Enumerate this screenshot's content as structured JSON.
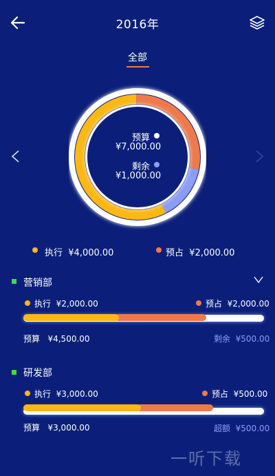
{
  "header": {
    "title": "2016年",
    "back_icon": "arrow-left-icon",
    "layers_icon": "layers-icon"
  },
  "tabs": [
    {
      "label": "全部",
      "active": true
    }
  ],
  "summary": {
    "budget_label": "预算",
    "budget_value": "¥7,000.00",
    "remaining_label": "剩余",
    "remaining_value": "¥1,000.00",
    "executed_label": "执行",
    "executed_value": "¥4,000.00",
    "reserved_label": "预占",
    "reserved_value": "¥2,000.00",
    "donut_fractions": {
      "executed": 0.5714,
      "reserved": 0.2857,
      "remaining": 0.1429
    }
  },
  "colors": {
    "background": "#0b1f7a",
    "executed": "#fdb813",
    "reserved": "#ee7a4a",
    "remaining": "#8c9cf7",
    "accent_green": "#3dde3d",
    "tab_underline": "#f07a44"
  },
  "departments": [
    {
      "name": "营销部",
      "executed_label": "执行",
      "executed_value": "¥2,000.00",
      "reserved_label": "预占",
      "reserved_value": "¥2,000.00",
      "budget_label": "预算",
      "budget_value": "¥4,500.00",
      "status_label": "剩余",
      "status_value": "¥500.00",
      "executed_fraction": 0.444,
      "reserved_fraction": 0.444,
      "expand_icon": "chevron-down-icon"
    },
    {
      "name": "研发部",
      "executed_label": "执行",
      "executed_value": "¥3,000.00",
      "reserved_label": "预占",
      "reserved_value": "¥500.00",
      "budget_label": "预算",
      "budget_value": "¥3,000.00",
      "status_label": "超额",
      "status_value": "¥500.00",
      "executed_fraction": 0.55,
      "reserved_fraction": 0.37
    }
  ],
  "watermark": "一听下载"
}
